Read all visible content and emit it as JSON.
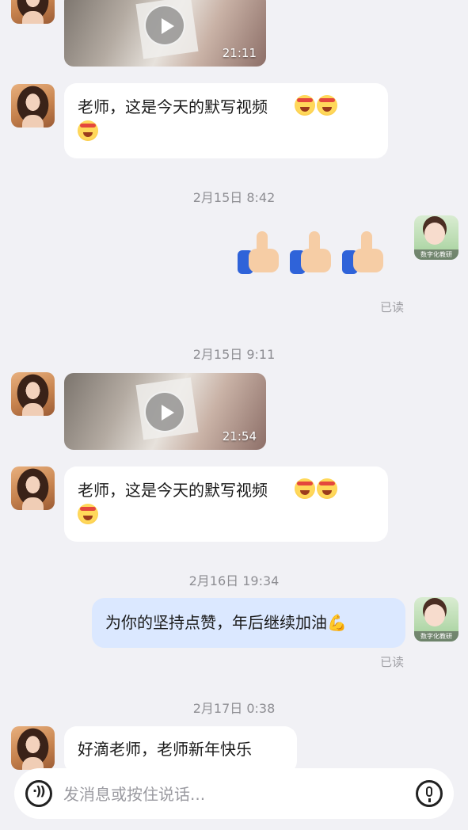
{
  "messages": {
    "m1": {
      "sender": "student",
      "type": "video",
      "duration": "21:11"
    },
    "m2": {
      "sender": "student",
      "type": "text",
      "text": "老师，这是今天的默写视频"
    },
    "t1": {
      "type": "timestamp",
      "text": "2月15日 8:42"
    },
    "m3": {
      "sender": "teacher",
      "type": "emoji",
      "emoji": "thumbs-up x3",
      "read": "已读"
    },
    "t2": {
      "type": "timestamp",
      "text": "2月15日 9:11"
    },
    "m4": {
      "sender": "student",
      "type": "video",
      "duration": "21:54"
    },
    "m5": {
      "sender": "student",
      "type": "text",
      "text": "老师，这是今天的默写视频"
    },
    "t3": {
      "type": "timestamp",
      "text": "2月16日 19:34"
    },
    "m6": {
      "sender": "teacher",
      "type": "text",
      "text": "为你的坚持点赞，年后继续加油",
      "read": "已读"
    },
    "t4": {
      "type": "timestamp",
      "text": "2月17日 0:38"
    },
    "m7": {
      "sender": "student",
      "type": "text",
      "text": "好滴老师，老师新年快乐"
    }
  },
  "teacher_avatar_caption": "数字化教研",
  "input": {
    "placeholder": "发消息或按住说话..."
  },
  "icons": {
    "voice": "voice-icon",
    "mic": "microphone-icon",
    "play": "play-icon"
  },
  "colors": {
    "background": "#f1f1f5",
    "my_bubble": "#dbe8ff",
    "their_bubble": "#ffffff"
  }
}
